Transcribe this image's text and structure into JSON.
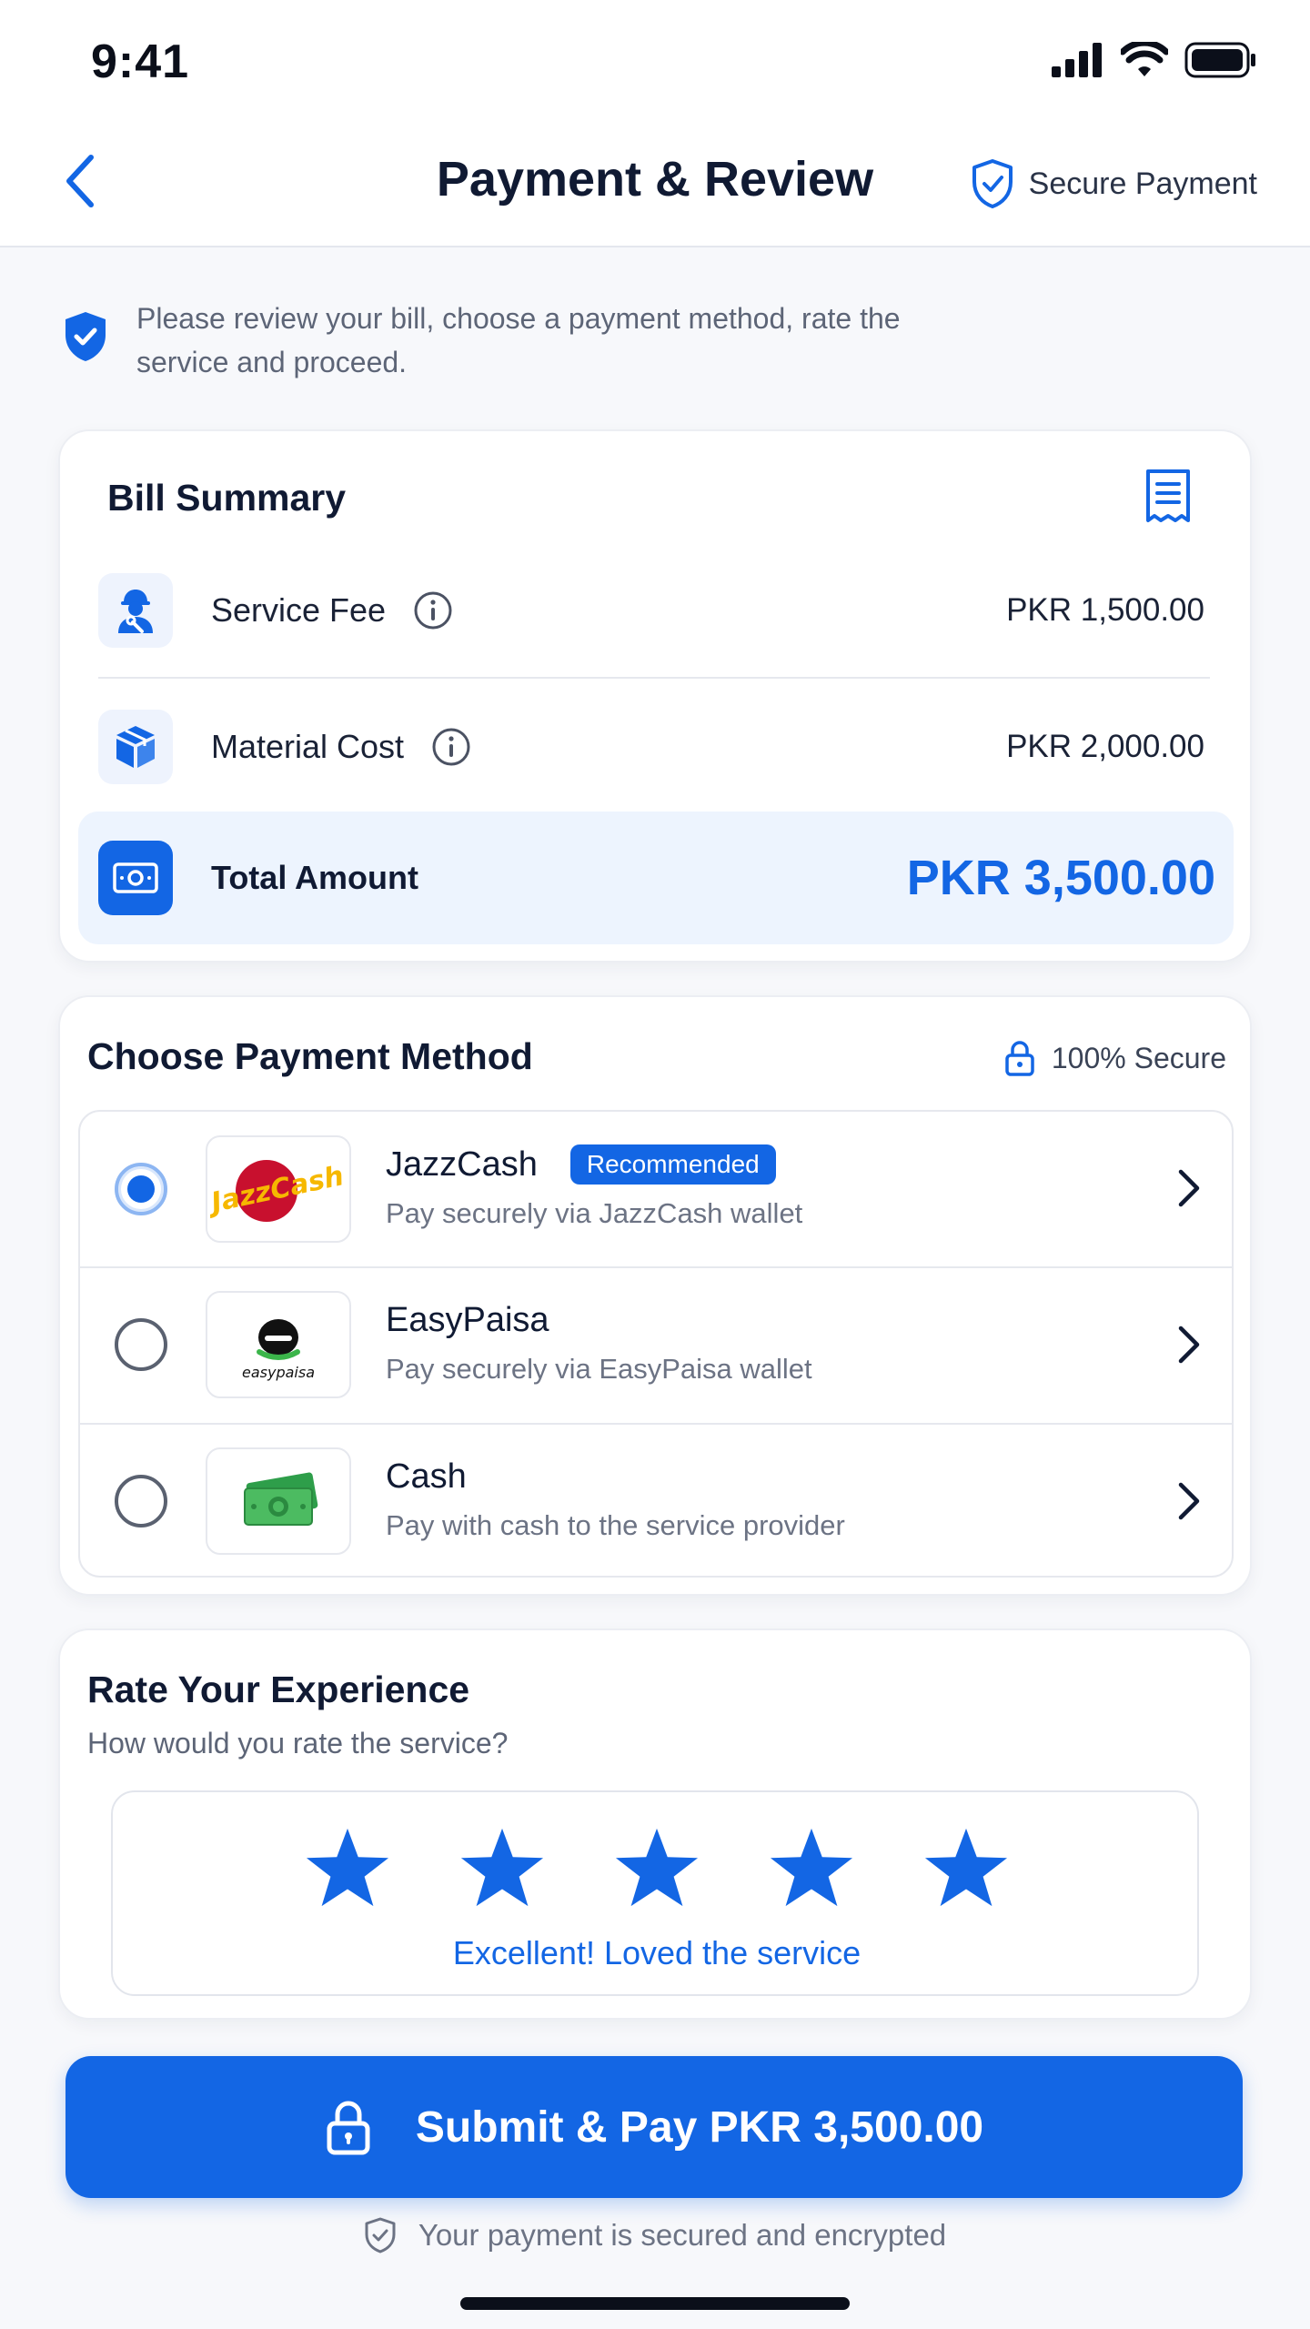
{
  "status_bar": {
    "time": "9:41"
  },
  "header": {
    "title": "Payment & Review",
    "secure_label": "Secure Payment"
  },
  "notice": {
    "text": "Please review your bill, choose a payment method, rate the service and proceed."
  },
  "bill_summary": {
    "title": "Bill Summary",
    "items": [
      {
        "label": "Service Fee",
        "amount": "PKR 1,500.00",
        "icon": "technician-icon"
      },
      {
        "label": "Material Cost",
        "amount": "PKR 2,000.00",
        "icon": "box-icon"
      }
    ],
    "total": {
      "label": "Total Amount",
      "amount": "PKR 3,500.00",
      "icon": "cash-icon"
    }
  },
  "payment": {
    "title": "Choose Payment Method",
    "secure_label": "100% Secure",
    "methods": [
      {
        "name": "JazzCash",
        "badge": "Recommended",
        "desc": "Pay securely via JazzCash wallet",
        "selected": true,
        "logo_text": "JazzCash"
      },
      {
        "name": "EasyPaisa",
        "badge": "",
        "desc": "Pay securely via EasyPaisa wallet",
        "selected": false,
        "logo_text": "easypaisa"
      },
      {
        "name": "Cash",
        "badge": "",
        "desc": "Pay with cash to the service provider",
        "selected": false,
        "logo_text": ""
      }
    ]
  },
  "rating": {
    "title": "Rate Your Experience",
    "subtitle": "How would you rate the service?",
    "stars": 5,
    "max_stars": 5,
    "caption": "Excellent! Loved the service"
  },
  "submit": {
    "label": "Submit & Pay PKR 3,500.00"
  },
  "footer": {
    "note": "Your payment is secured and encrypted"
  },
  "colors": {
    "primary": "#1366e4",
    "text": "#101a33",
    "muted": "#6c7384",
    "jazz_red": "#c8102e",
    "jazz_yellow": "#f6b800",
    "easypaisa_green": "#3bb54a"
  }
}
